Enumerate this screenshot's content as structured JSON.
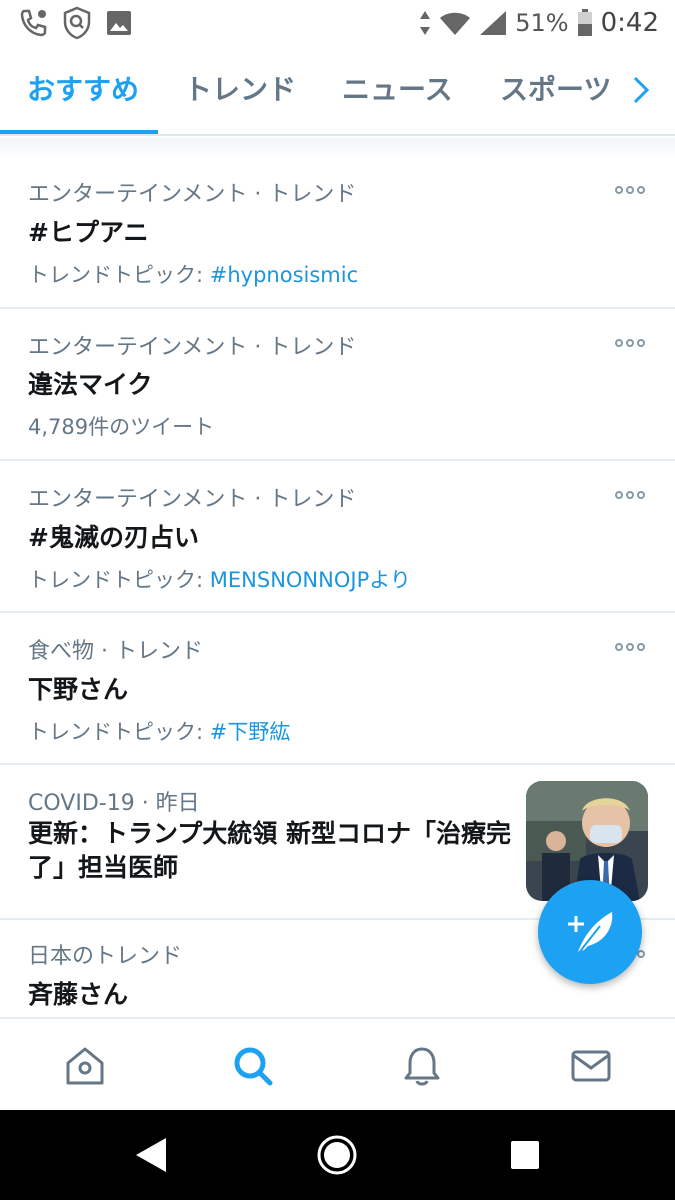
{
  "status_bar": {
    "icons": [
      "call-settings-icon",
      "shield-search-icon",
      "image-icon",
      "data-arrows-icon",
      "wifi-icon",
      "signal-icon",
      "battery-icon"
    ],
    "battery": "51%",
    "time": "0:42"
  },
  "tabs": [
    {
      "label": "おすすめ",
      "active": true
    },
    {
      "label": "トレンド",
      "active": false
    },
    {
      "label": "ニュース",
      "active": false
    },
    {
      "label": "スポーツ",
      "active": false
    }
  ],
  "trends": [
    {
      "meta": "エンターテインメント · トレンド",
      "title": "#ヒプアニ",
      "sub_prefix": "トレンドトピック:",
      "sub_link": "#hypnosismic"
    },
    {
      "meta": "エンターテインメント · トレンド",
      "title": "違法マイク",
      "sub_text": "4,789件のツイート"
    },
    {
      "meta": "エンターテインメント · トレンド",
      "title": "#鬼滅の刃占い",
      "sub_prefix": "トレンドトピック:",
      "sub_link": "MENSNONNOJPより"
    },
    {
      "meta": "食べ物 · トレンド",
      "title": "下野さん",
      "sub_prefix": "トレンドトピック:",
      "sub_link": "#下野紘"
    }
  ],
  "news": {
    "meta": "COVID-19 · 昨日",
    "title": "更新：トランプ大統領 新型コロナ「治療完了」担当医師"
  },
  "last_trend": {
    "meta": "日本のトレンド",
    "title": "斉藤さん"
  },
  "bottom_nav": [
    "home-icon",
    "search-icon",
    "notifications-icon",
    "messages-icon"
  ],
  "colors": {
    "accent": "#1da1f2",
    "link": "#1b95e0",
    "text": "#14171a",
    "muted": "#657786"
  }
}
